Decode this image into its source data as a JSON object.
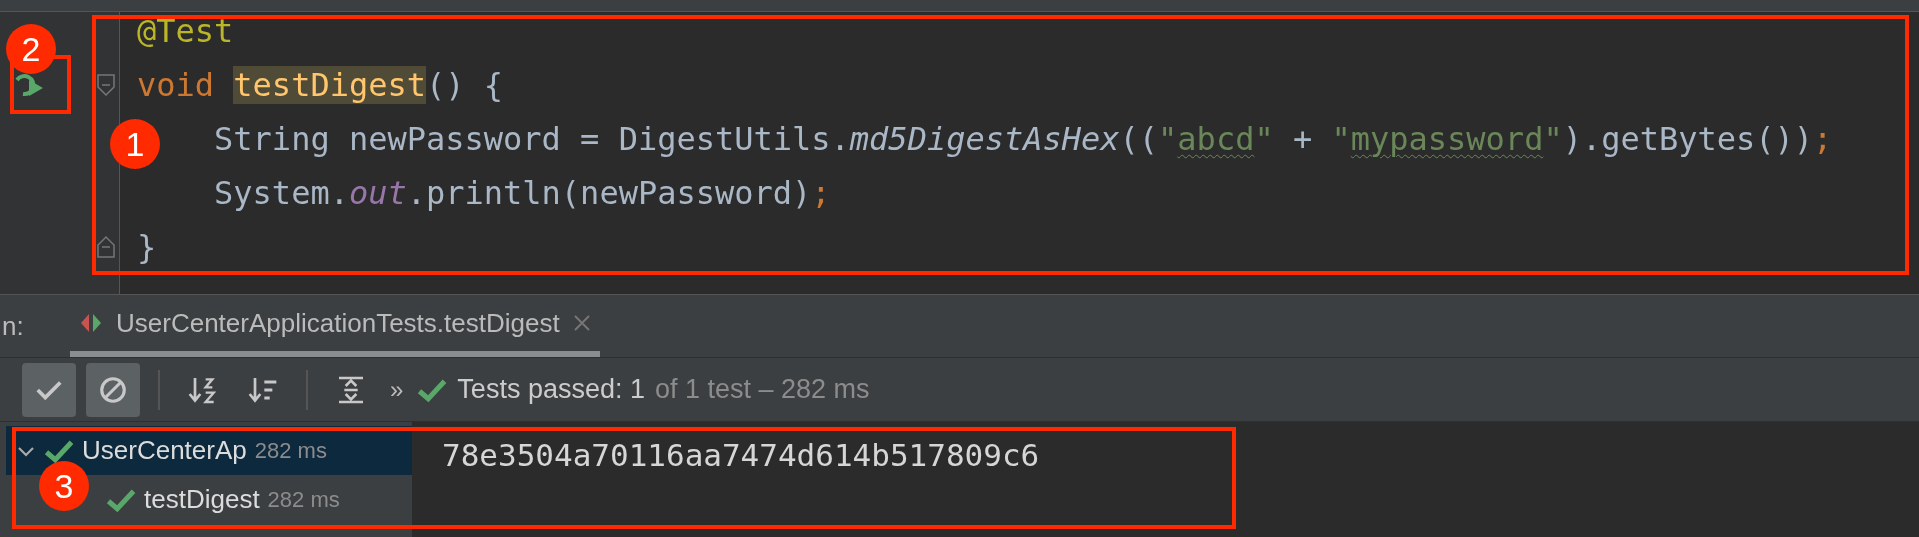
{
  "editor": {
    "lines": [
      {
        "tokens": [
          {
            "kind": "annotation",
            "text": "@Test"
          }
        ]
      },
      {
        "fold_start": true,
        "run_icon": true,
        "tokens": [
          {
            "kind": "keyword",
            "text": "void "
          },
          {
            "kind": "declaration",
            "text": "testDigest"
          },
          {
            "kind": "plain",
            "text": "() {"
          }
        ]
      },
      {
        "tokens": [
          {
            "kind": "plain",
            "text": "    String newPassword = DigestUtils."
          },
          {
            "kind": "italic",
            "text": "md5DigestAsHex"
          },
          {
            "kind": "plain",
            "text": "(("
          },
          {
            "kind": "string",
            "text": "\""
          },
          {
            "kind": "string",
            "text": "abcd",
            "typo": true
          },
          {
            "kind": "string",
            "text": "\""
          },
          {
            "kind": "plain",
            "text": " + "
          },
          {
            "kind": "string",
            "text": "\""
          },
          {
            "kind": "string",
            "text": "mypassword",
            "typo": true
          },
          {
            "kind": "string",
            "text": "\""
          },
          {
            "kind": "plain",
            "text": ").getBytes())"
          },
          {
            "kind": "punct",
            "text": ";"
          }
        ]
      },
      {
        "tokens": [
          {
            "kind": "plain",
            "text": "    System."
          },
          {
            "kind": "field",
            "text": "out"
          },
          {
            "kind": "plain",
            "text": ".println(newPassword)"
          },
          {
            "kind": "punct",
            "text": ";"
          }
        ]
      },
      {
        "fold_end": true,
        "tokens": [
          {
            "kind": "plain",
            "text": "}"
          }
        ]
      }
    ]
  },
  "run_panel": {
    "label": "n:",
    "tabs": [
      {
        "label": "UserCenterApplicationTests.testDigest",
        "selected": true
      }
    ],
    "toolbar": [
      {
        "kind": "show-passed",
        "on": true
      },
      {
        "kind": "show-ignored",
        "on": true
      },
      {
        "kind": "sep"
      },
      {
        "kind": "sort-alpha"
      },
      {
        "kind": "sort-duration"
      },
      {
        "kind": "sep"
      },
      {
        "kind": "expand"
      },
      {
        "kind": "more",
        "text": "»"
      }
    ],
    "status": {
      "passed": true,
      "main": "Tests passed: 1",
      "detail": "of 1 test – 282 ms"
    },
    "tree": [
      {
        "label": "UserCenterAp",
        "duration": "282 ms",
        "passed": true,
        "expanded": true,
        "selected": true,
        "children": [
          {
            "label": "testDigest",
            "duration": "282 ms",
            "passed": true,
            "selected": false
          }
        ]
      }
    ],
    "output": [
      "78e3504a70116aa7474d614b517809c6"
    ]
  },
  "annotations": [
    {
      "label": "1"
    },
    {
      "label": "2"
    },
    {
      "label": "3"
    }
  ]
}
